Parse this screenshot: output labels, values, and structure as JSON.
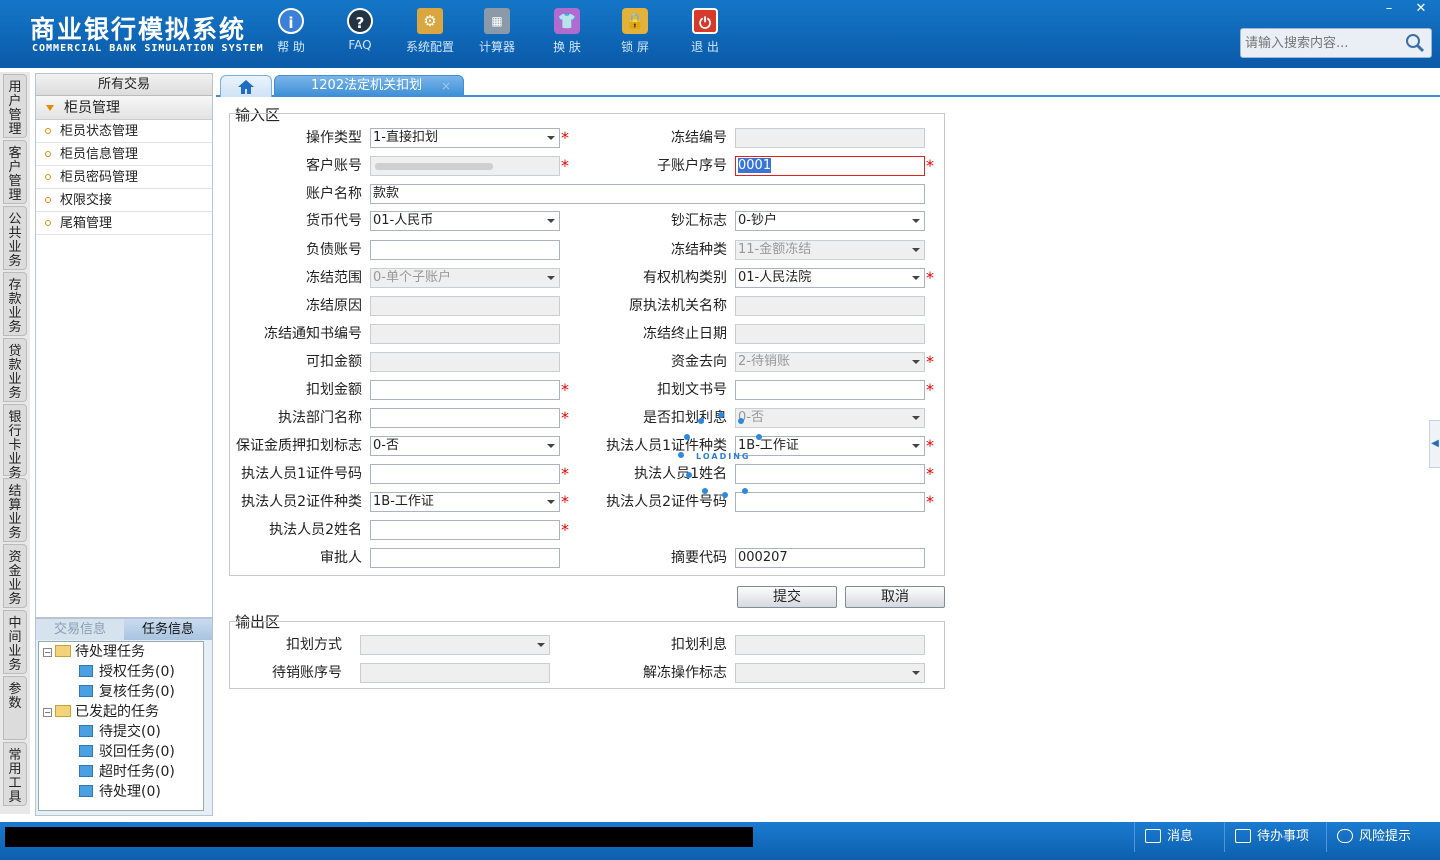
{
  "header": {
    "title_cn": "商业银行模拟系统",
    "title_en": "COMMERCIAL BANK SIMULATION SYSTEM",
    "toolbar": [
      {
        "label": "帮 助",
        "icon": "help-icon"
      },
      {
        "label": "FAQ",
        "icon": "faq-icon"
      },
      {
        "label": "系统配置",
        "icon": "settings-icon"
      },
      {
        "label": "计算器",
        "icon": "calculator-icon"
      },
      {
        "label": "换 肤",
        "icon": "skin-icon"
      },
      {
        "label": "锁 屏",
        "icon": "lock-icon"
      },
      {
        "label": "退 出",
        "icon": "power-icon"
      }
    ],
    "search_placeholder": "请输入搜索内容...",
    "window_controls": {
      "minimize": "–",
      "close": "✕"
    }
  },
  "vnav": [
    "用户管理",
    "客户管理",
    "公共业务",
    "存款业务",
    "贷款业务",
    "银行卡业务",
    "结算业务",
    "资金业务",
    "中间业务",
    "参数",
    "常用工具"
  ],
  "left_panel": {
    "header": "所有交易",
    "group": "柜员管理",
    "items": [
      "柜员状态管理",
      "柜员信息管理",
      "柜员密码管理",
      "权限交接",
      "尾箱管理"
    ]
  },
  "task_panel": {
    "tabs": [
      "交易信息",
      "任务信息"
    ],
    "tree": [
      {
        "label": "待处理任务",
        "children": [
          "授权任务(0)",
          "复核任务(0)"
        ]
      },
      {
        "label": "已发起的任务",
        "children": [
          "待提交(0)",
          "驳回任务(0)",
          "超时任务(0)",
          "待处理(0)"
        ]
      }
    ]
  },
  "tabs": {
    "active": "1202法定机关扣划",
    "close": "×"
  },
  "input_area": {
    "title": "输入区",
    "fields": {
      "op_type": {
        "label": "操作类型",
        "value": "1-直接扣划"
      },
      "freeze_no": {
        "label": "冻结编号",
        "value": ""
      },
      "cust_acct": {
        "label": "客户账号",
        "value": ""
      },
      "sub_acct": {
        "label": "子账户序号",
        "value": "0001"
      },
      "acct_name": {
        "label": "账户名称",
        "value": "款款"
      },
      "currency": {
        "label": "货币代号",
        "value": "01-人民币"
      },
      "cash_flag": {
        "label": "钞汇标志",
        "value": "0-钞户"
      },
      "debt_acct": {
        "label": "负债账号",
        "value": ""
      },
      "freeze_kind": {
        "label": "冻结种类",
        "value": "11-金额冻结"
      },
      "freeze_scope": {
        "label": "冻结范围",
        "value": "0-单个子账户"
      },
      "org_type": {
        "label": "有权机构类别",
        "value": "01-人民法院"
      },
      "freeze_reason": {
        "label": "冻结原因",
        "value": ""
      },
      "orig_org": {
        "label": "原执法机关名称",
        "value": ""
      },
      "notice_no": {
        "label": "冻结通知书编号",
        "value": ""
      },
      "freeze_end": {
        "label": "冻结终止日期",
        "value": ""
      },
      "deductible": {
        "label": "可扣金额",
        "value": ""
      },
      "fund_dest": {
        "label": "资金去向",
        "value": "2-待销账"
      },
      "deduct_amt": {
        "label": "扣划金额",
        "value": ""
      },
      "deduct_doc": {
        "label": "扣划文书号",
        "value": ""
      },
      "dept_name": {
        "label": "执法部门名称",
        "value": ""
      },
      "interest_flag": {
        "label": "是否扣划利息",
        "value": "0-否"
      },
      "pledge_flag": {
        "label": "保证金质押扣划标志",
        "value": "0-否"
      },
      "p1_idtype": {
        "label": "执法人员1证件种类",
        "value": "1B-工作证"
      },
      "p1_idno": {
        "label": "执法人员1证件号码",
        "value": ""
      },
      "p1_name": {
        "label": "执法人员1姓名",
        "value": ""
      },
      "p2_idtype": {
        "label": "执法人员2证件种类",
        "value": "1B-工作证"
      },
      "p2_idno": {
        "label": "执法人员2证件号码",
        "value": ""
      },
      "p2_name": {
        "label": "执法人员2姓名",
        "value": ""
      },
      "approver": {
        "label": "审批人",
        "value": ""
      },
      "summary": {
        "label": "摘要代码",
        "value": "000207"
      }
    },
    "submit": "提交",
    "cancel": "取消"
  },
  "output_area": {
    "title": "输出区",
    "fields": {
      "method": {
        "label": "扣划方式",
        "value": ""
      },
      "interest": {
        "label": "扣划利息",
        "value": ""
      },
      "pending_no": {
        "label": "待销账序号",
        "value": ""
      },
      "unfreeze": {
        "label": "解冻操作标志",
        "value": ""
      }
    }
  },
  "loading_text": "LOADING",
  "status_bar": [
    "消息",
    "待办事项",
    "风险提示"
  ]
}
